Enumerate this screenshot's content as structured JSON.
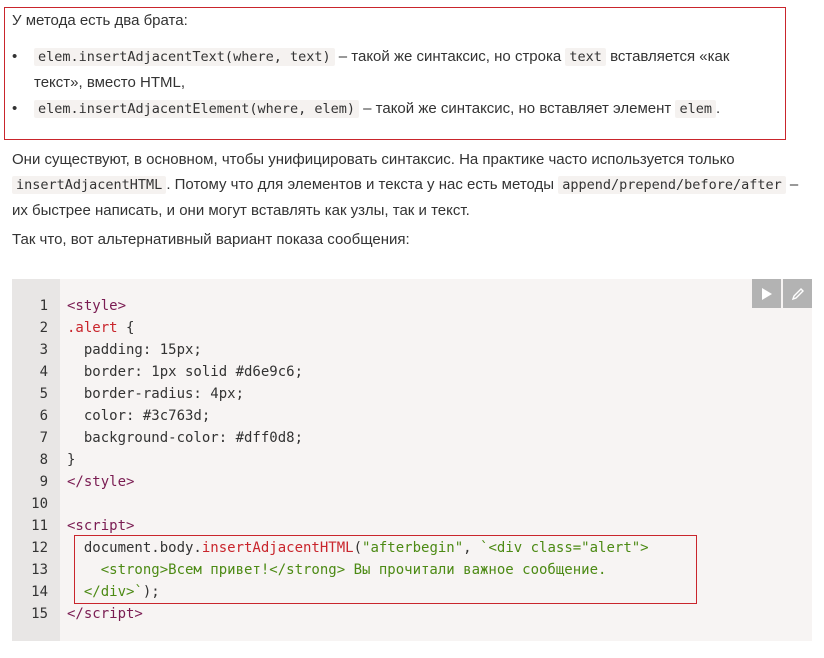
{
  "intro": "У метода есть два брата:",
  "bullets": [
    {
      "code": "elem.insertAdjacentText(where, text)",
      "text1": " – такой же синтаксис, но строка ",
      "code2": "text",
      "text2": " вставляется «как текст», вместо HTML,"
    },
    {
      "code": "elem.insertAdjacentElement(where, elem)",
      "text1": " – такой же синтаксис, но вставляет элемент ",
      "code2": "elem",
      "text2": "."
    }
  ],
  "para": {
    "t1": "Они существуют, в основном, чтобы унифицировать синтаксис. На практике часто используется только ",
    "c1": "insertAdjacentHTML",
    "t2": ". Потому что для элементов и текста у нас есть методы ",
    "c2": "append/prepend/before/after",
    "t3": " – их быстрее написать, и они могут вставлять как узлы, так и текст."
  },
  "para2": "Так что, вот альтернативный вариант показа сообщения:",
  "code": {
    "line_numbers": [
      "1",
      "2",
      "3",
      "4",
      "5",
      "6",
      "7",
      "8",
      "9",
      "10",
      "11",
      "12",
      "13",
      "14",
      "15"
    ],
    "run_icon": "play-icon",
    "edit_icon": "pencil-icon",
    "highlight_color": "#c9252c"
  }
}
